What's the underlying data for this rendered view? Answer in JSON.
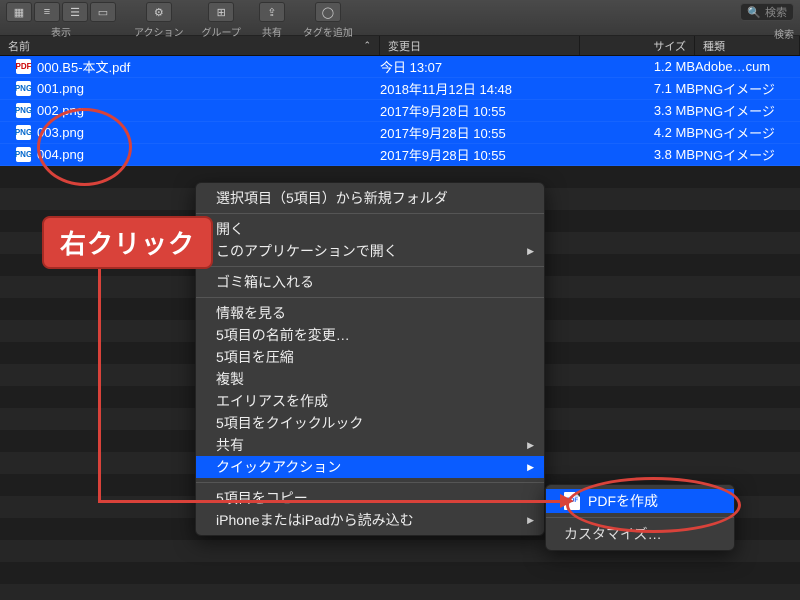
{
  "toolbar": {
    "view_label": "表示",
    "action_label": "アクション",
    "group_label": "グループ",
    "share_label": "共有",
    "tag_label": "タグを追加",
    "search_placeholder": "検索",
    "search_label": "検索"
  },
  "columns": {
    "name": "名前",
    "date": "変更日",
    "size": "サイズ",
    "kind": "種類",
    "sort_indicator": "⌃"
  },
  "files": [
    {
      "icon": "pdf",
      "name": "000.B5-本文.pdf",
      "date": "今日 13:07",
      "size": "1.2 MB",
      "kind": "Adobe…cum"
    },
    {
      "icon": "png",
      "name": "001.png",
      "date": "2018年11月12日 14:48",
      "size": "7.1 MB",
      "kind": "PNGイメージ"
    },
    {
      "icon": "png",
      "name": "002.png",
      "date": "2017年9月28日 10:55",
      "size": "3.3 MB",
      "kind": "PNGイメージ"
    },
    {
      "icon": "png",
      "name": "003.png",
      "date": "2017年9月28日 10:55",
      "size": "4.2 MB",
      "kind": "PNGイメージ"
    },
    {
      "icon": "png",
      "name": "004.png",
      "date": "2017年9月28日 10:55",
      "size": "3.8 MB",
      "kind": "PNGイメージ"
    }
  ],
  "context_menu": {
    "items": [
      {
        "label": "選択項目（5項目）から新規フォルダ",
        "type": "item"
      },
      {
        "type": "sep"
      },
      {
        "label": "開く",
        "type": "item"
      },
      {
        "label": "このアプリケーションで開く",
        "type": "sub"
      },
      {
        "type": "sep"
      },
      {
        "label": "ゴミ箱に入れる",
        "type": "item"
      },
      {
        "type": "sep"
      },
      {
        "label": "情報を見る",
        "type": "item"
      },
      {
        "label": "5項目の名前を変更…",
        "type": "item"
      },
      {
        "label": "5項目を圧縮",
        "type": "item"
      },
      {
        "label": "複製",
        "type": "item"
      },
      {
        "label": "エイリアスを作成",
        "type": "item"
      },
      {
        "label": "5項目をクイックルック",
        "type": "item"
      },
      {
        "label": "共有",
        "type": "sub"
      },
      {
        "label": "クイックアクション",
        "type": "sub",
        "highlight": true
      },
      {
        "type": "sep"
      },
      {
        "label": "5項目をコピー",
        "type": "item"
      },
      {
        "label": "iPhoneまたはiPadから読み込む",
        "type": "sub"
      }
    ]
  },
  "submenu": {
    "pdf_label": "PDFを作成",
    "customize_label": "カスタマイズ…"
  },
  "annotation": {
    "right_click": "右クリック"
  }
}
